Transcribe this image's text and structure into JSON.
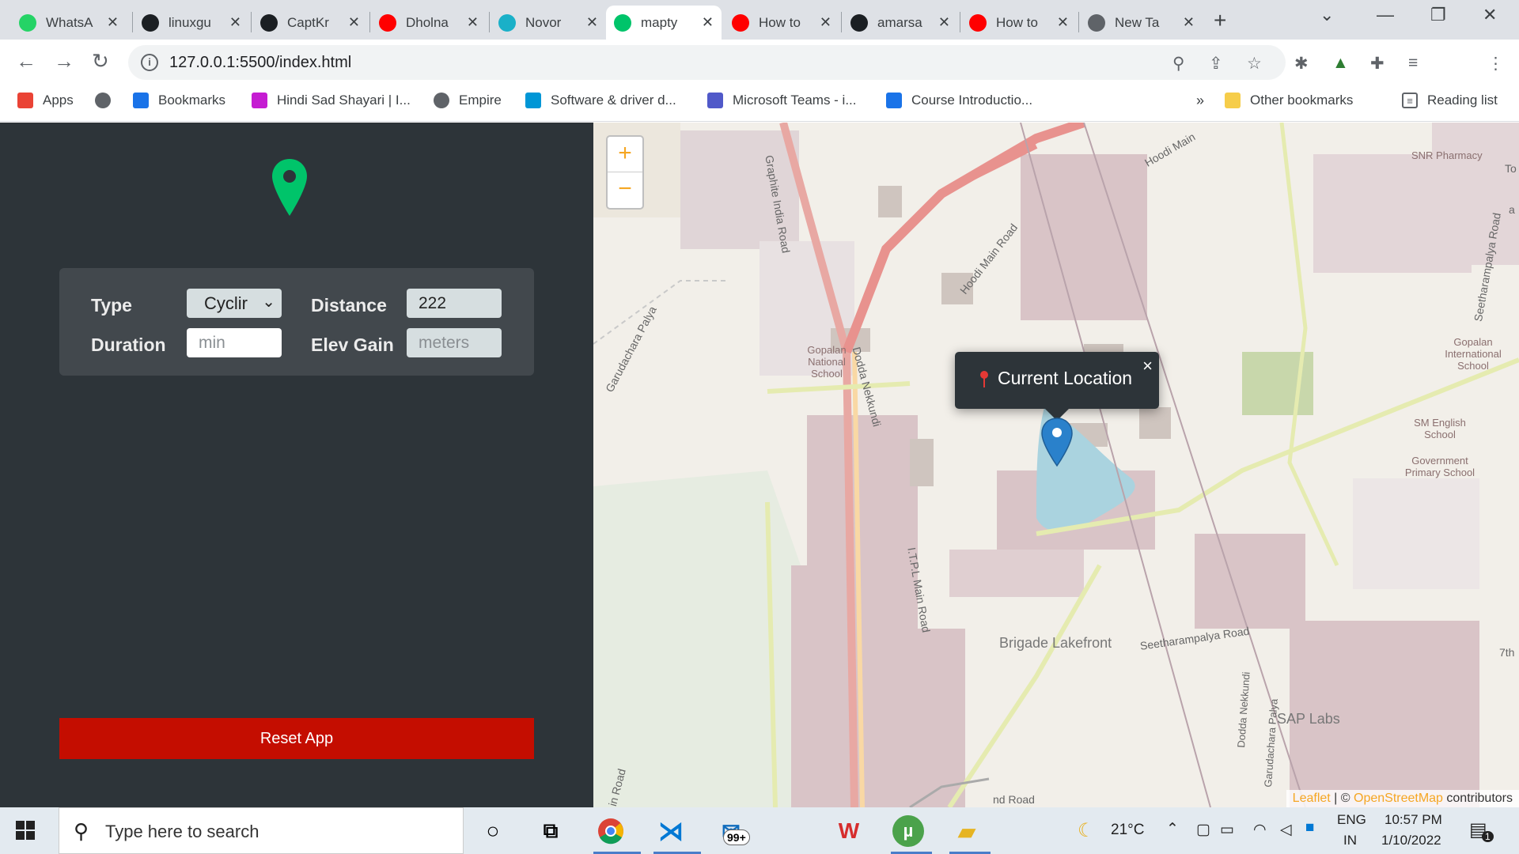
{
  "browser": {
    "tabs": [
      {
        "title": "WhatsApp",
        "icon": "whatsapp-icon",
        "color": "#25d366",
        "active": false
      },
      {
        "title": "linuxgu",
        "icon": "github-icon",
        "color": "#1b1f23",
        "active": false
      },
      {
        "title": "CaptKr",
        "icon": "github-icon",
        "color": "#1b1f23",
        "active": false
      },
      {
        "title": "Dholna",
        "icon": "youtube-icon",
        "color": "#ff0000",
        "active": false
      },
      {
        "title": "Novor",
        "icon": "novorender-icon",
        "color": "#1ab0c8",
        "active": false
      },
      {
        "title": "mapty",
        "icon": "mapty-icon",
        "color": "#00c46a",
        "active": true
      },
      {
        "title": "How to",
        "icon": "youtube-icon",
        "color": "#ff0000",
        "active": false
      },
      {
        "title": "amarsa",
        "icon": "github-icon",
        "color": "#1b1f23",
        "active": false
      },
      {
        "title": "How to",
        "icon": "youtube-icon",
        "color": "#ff0000",
        "active": false
      },
      {
        "title": "New Ta",
        "icon": "chrome-icon",
        "color": "#5f6368",
        "active": false
      }
    ],
    "url": "127.0.0.1:5500/index.html",
    "bookmarks": [
      {
        "label": "Apps",
        "icon": "apps-grid-icon"
      },
      {
        "label": "",
        "icon": "globe-icon"
      },
      {
        "label": "Bookmarks",
        "icon": "star-icon"
      },
      {
        "label": "Hindi Sad Shayari | I...",
        "icon": "ls-icon"
      },
      {
        "label": "Empire",
        "icon": "globe-icon"
      },
      {
        "label": "Software & driver d...",
        "icon": "hp-icon"
      },
      {
        "label": "Microsoft Teams - i...",
        "icon": "teams-icon"
      },
      {
        "label": "Course Introductio...",
        "icon": "c-icon"
      }
    ],
    "overflow": "»",
    "other_bookmarks": "Other bookmarks",
    "reading_list": "Reading list"
  },
  "app": {
    "form": {
      "type_label": "Type",
      "type_value": "Cyclir",
      "distance_label": "Distance",
      "distance_value": "222",
      "duration_label": "Duration",
      "duration_placeholder": "min",
      "elev_label": "Elev Gain",
      "elev_placeholder": "meters"
    },
    "reset_label": "Reset App",
    "accent": "#00c46a"
  },
  "map": {
    "zoom_in": "+",
    "zoom_out": "−",
    "popup_text": "Current Location",
    "popup_close": "×",
    "attribution_leaflet": "Leaflet",
    "attribution_sep": " | © ",
    "attribution_osm": "OpenStreetMap",
    "attribution_rest": " contributors",
    "labels": {
      "graphite": "Graphite India Road",
      "hoodi1": "Hoodi Main Road",
      "hoodi2": "Hoodi Main",
      "gopalan_nat": "Gopalan National School",
      "dodda": "Dodda Nekkundi",
      "garud": "Garudachara Palya",
      "itpl": "I.T.P.L Main Road",
      "brigade": "Brigade Lakefront",
      "seeth": "Seetharampalya Road",
      "sap": "SAP Labs",
      "snr": "SNR Pharmacy",
      "gopalan_int": "Gopalan International School",
      "sm": "SM English School",
      "govt": "Government Primary School",
      "seeth2": "Seetharampalya Road",
      "seventh": "7th",
      "to": "To",
      "a": "a",
      "road_bottom_left": "in Road",
      "road_bottom": "nd Road",
      "dodda2": "Dodda Nekkundi",
      "garud2": "Garudachara Palya"
    }
  },
  "taskbar": {
    "search_placeholder": "Type here to search",
    "mail_badge": "99+",
    "temperature": "21°C",
    "lang": "ENG",
    "region": "IN",
    "time": "10:57 PM",
    "date": "1/10/2022",
    "notif_count": "1"
  }
}
